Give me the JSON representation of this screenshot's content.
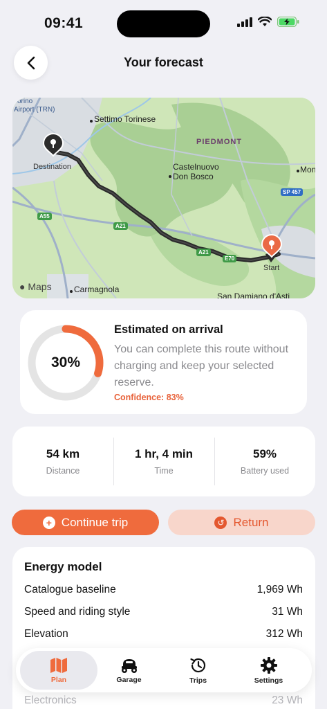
{
  "status": {
    "time": "09:41"
  },
  "header": {
    "title": "Your forecast"
  },
  "map": {
    "labels": {
      "airport": "Torino\nAirport (TRN)",
      "settimo": "Settimo Torinese",
      "piedmont": "PIEDMONT",
      "destination": "Destination",
      "castelnuovo": "Castelnuovo\nDon Bosco",
      "mon": "Mon",
      "start": "Start",
      "carmagnola": "Carmagnola",
      "san_damiano": "San Damiano d'Asti",
      "maps": "Maps"
    },
    "shields": {
      "a55": "A55",
      "a21a": "A21",
      "a21b": "A21",
      "e70": "E70",
      "sp457": "SP 457"
    }
  },
  "arrival": {
    "percent_value": 30,
    "percent_label": "30%",
    "title": "Estimated on arrival",
    "description": "You can complete this route without charging and keep your selected reserve.",
    "confidence": "Confidence: 83%"
  },
  "stats": [
    {
      "value": "54 km",
      "label": "Distance"
    },
    {
      "value": "1 hr, 4 min",
      "label": "Time"
    },
    {
      "value": "59%",
      "label": "Battery used"
    }
  ],
  "actions": {
    "continue": "Continue trip",
    "return": "Return"
  },
  "energy": {
    "title": "Energy model",
    "rows": [
      {
        "label": "Catalogue baseline",
        "value": "1,969 Wh"
      },
      {
        "label": "Speed and riding style",
        "value": "31 Wh"
      },
      {
        "label": "Elevation",
        "value": "312 Wh"
      },
      {
        "label": "Electronics",
        "value": "23 Wh"
      }
    ]
  },
  "tabs": [
    {
      "label": "Plan",
      "icon": "map-icon",
      "active": true
    },
    {
      "label": "Garage",
      "icon": "scooter-icon",
      "active": false
    },
    {
      "label": "Trips",
      "icon": "history-icon",
      "active": false
    },
    {
      "label": "Settings",
      "icon": "gear-icon",
      "active": false
    }
  ],
  "colors": {
    "accent": "#ef6b3d",
    "return_bg": "#f8d6cb",
    "ring_track": "#e4e4e4"
  }
}
